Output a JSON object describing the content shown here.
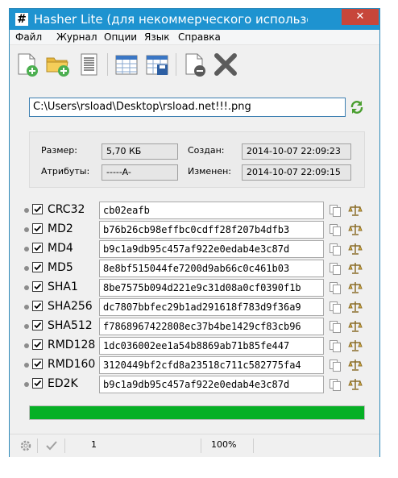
{
  "window": {
    "title": "Hasher Lite (для некоммерческого использов...",
    "app_icon": "#",
    "close": "✕"
  },
  "menu": [
    "Файл",
    "Журнал",
    "Опции",
    "Язык",
    "Справка"
  ],
  "toolbar": [
    "new-file-icon",
    "add-folder-icon",
    "text-document-icon",
    "spreadsheet-icon",
    "save-table-icon",
    "remove-file-icon",
    "delete-x-icon"
  ],
  "file": {
    "path": "C:\\Users\\rsload\\Desktop\\rsload.net!!!.png"
  },
  "info": {
    "size_label": "Размер:",
    "size_value": "5,70 КБ",
    "attr_label": "Атрибуты:",
    "attr_value": "-----A-",
    "created_label": "Создан:",
    "created_value": "2014-10-07 22:09:23",
    "modified_label": "Изменен:",
    "modified_value": "2014-10-07 22:09:15"
  },
  "hashes": [
    {
      "algo": "CRC32",
      "value": "cb02eafb"
    },
    {
      "algo": "MD2",
      "value": "b76b26cb98effbc0cdff28f207b4dfb3"
    },
    {
      "algo": "MD4",
      "value": "b9c1a9db95c457af922e0edab4e3c87d"
    },
    {
      "algo": "MD5",
      "value": "8e8bf515044fe7200d9ab66c0c461b03"
    },
    {
      "algo": "SHA1",
      "value": "8be7575b094d221e9c31d08a0cf0390f1b"
    },
    {
      "algo": "SHA256",
      "value": "dc7807bbfec29b1ad291618f783d9f36a9"
    },
    {
      "algo": "SHA512",
      "value": "f7868967422808ec37b4be1429cf83cb96"
    },
    {
      "algo": "RMD128",
      "value": "1dc036002ee1a54b8869ab71b85fe447"
    },
    {
      "algo": "RMD160",
      "value": "3120449bf2cfd8a23518c711c582775fa4"
    },
    {
      "algo": "ED2K",
      "value": "b9c1a9db95c457af922e0edab4e3c87d"
    }
  ],
  "progress": {
    "percent": 100,
    "color": "#06b025"
  },
  "status": {
    "count": "1",
    "zoom": "100%"
  },
  "colors": {
    "titlebar": "#1e93d0",
    "close": "#c7463a"
  }
}
